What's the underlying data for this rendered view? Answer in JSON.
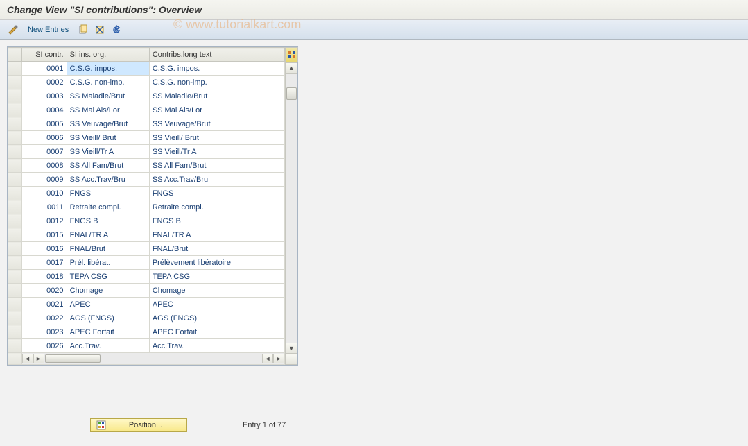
{
  "title": "Change View \"SI contributions\": Overview",
  "watermark": "© www.tutorialkart.com",
  "toolbar": {
    "new_entries": "New Entries"
  },
  "table": {
    "headers": {
      "si_contr": "SI contr.",
      "si_ins_org": "SI ins. org.",
      "contribs_long": "Contribs.long text"
    },
    "rows": [
      {
        "code": "0001",
        "org": "C.S.G. impos.",
        "long": "C.S.G. impos.",
        "hl": true
      },
      {
        "code": "0002",
        "org": "C.S.G. non-imp.",
        "long": "C.S.G. non-imp."
      },
      {
        "code": "0003",
        "org": "SS Maladie/Brut",
        "long": "SS Maladie/Brut"
      },
      {
        "code": "0004",
        "org": "SS Mal Als/Lor",
        "long": "SS Mal Als/Lor"
      },
      {
        "code": "0005",
        "org": "SS Veuvage/Brut",
        "long": "SS Veuvage/Brut"
      },
      {
        "code": "0006",
        "org": "SS Vieill/ Brut",
        "long": "SS Vieill/ Brut"
      },
      {
        "code": "0007",
        "org": "SS Vieill/Tr A",
        "long": "SS Vieill/Tr A"
      },
      {
        "code": "0008",
        "org": "SS All Fam/Brut",
        "long": "SS All Fam/Brut"
      },
      {
        "code": "0009",
        "org": "SS Acc.Trav/Bru",
        "long": "SS Acc.Trav/Bru"
      },
      {
        "code": "0010",
        "org": "FNGS",
        "long": "FNGS"
      },
      {
        "code": "0011",
        "org": "Retraite compl.",
        "long": "Retraite compl."
      },
      {
        "code": "0012",
        "org": "FNGS B",
        "long": "FNGS B"
      },
      {
        "code": "0015",
        "org": "FNAL/TR A",
        "long": "FNAL/TR A"
      },
      {
        "code": "0016",
        "org": "FNAL/Brut",
        "long": "FNAL/Brut"
      },
      {
        "code": "0017",
        "org": "Prél. libérat.",
        "long": "Prélèvement libératoire"
      },
      {
        "code": "0018",
        "org": "TEPA CSG",
        "long": "TEPA CSG"
      },
      {
        "code": "0020",
        "org": "Chomage",
        "long": "Chomage"
      },
      {
        "code": "0021",
        "org": "APEC",
        "long": "APEC"
      },
      {
        "code": "0022",
        "org": "AGS (FNGS)",
        "long": "AGS (FNGS)"
      },
      {
        "code": "0023",
        "org": "APEC Forfait",
        "long": "APEC Forfait"
      },
      {
        "code": "0026",
        "org": "Acc.Trav.",
        "long": "Acc.Trav."
      }
    ]
  },
  "footer": {
    "position_label": "Position...",
    "entry_text": "Entry 1 of 77"
  }
}
